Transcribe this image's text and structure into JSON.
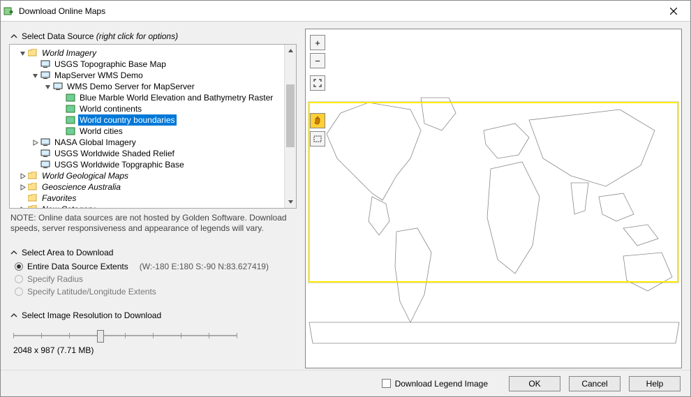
{
  "window_title": "Download Online Maps",
  "sections": {
    "data_source": {
      "label": "Select Data Source",
      "hint": "(right click for options)"
    },
    "area": {
      "label": "Select Area to Download"
    },
    "resolution": {
      "label": "Select Image Resolution to Download"
    }
  },
  "tree": {
    "root1": "World Imagery",
    "usgs_topo": "USGS Topographic Base Map",
    "mapserver": "MapServer WMS Demo",
    "wms_demo_server": "WMS Demo Server for MapServer",
    "blue_marble": "Blue Marble World Elevation and Bathymetry Raster",
    "continents": "World continents",
    "country_boundaries": "World country boundaries",
    "cities": "World cities",
    "nasa": "NASA Global Imagery",
    "usgs_shaded": "USGS Worldwide Shaded Relief",
    "usgs_topg": "USGS Worldwide Topgraphic Base",
    "geo_maps": "World Geological Maps",
    "geoscience_au": "Geoscience Australia",
    "favorites": "Favorites",
    "new_category": "New Category"
  },
  "note": "NOTE: Online data sources are not hosted by Golden Software.  Download speeds, server responsiveness and appearance of legends will vary.",
  "area_options": {
    "entire": "Entire Data Source Extents",
    "extents": "(W:-180 E:180 S:-90 N:83.627419)",
    "radius": "Specify Radius",
    "latlon": "Specify Latitude/Longitude Extents"
  },
  "resolution": {
    "value": "2048 x 987  (7.71 MB)"
  },
  "buttons": {
    "download_legend": "Download Legend Image",
    "ok": "OK",
    "cancel": "Cancel",
    "help": "Help"
  },
  "map_tools": {
    "zoom_in": "plus-icon",
    "zoom_out": "minus-icon",
    "fit": "fit-icon",
    "pan": "hand-icon",
    "select": "rectangle-select-icon"
  }
}
